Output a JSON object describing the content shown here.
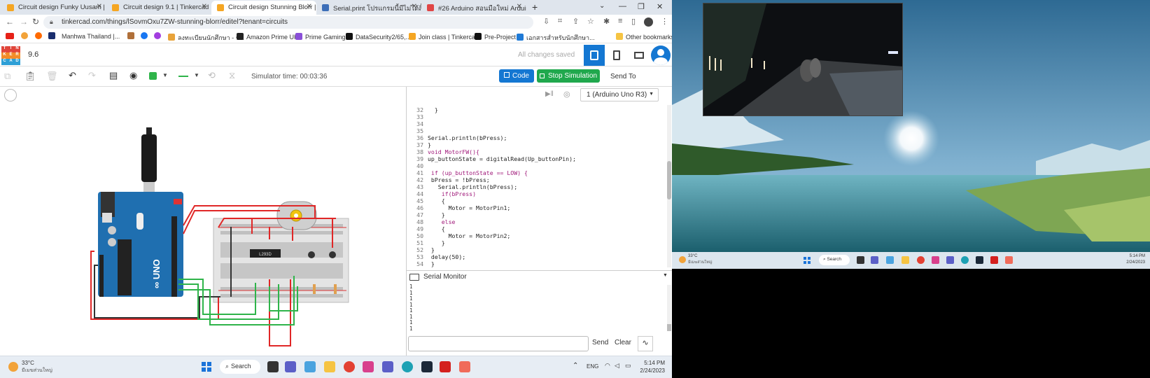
{
  "browser": {
    "tabs": [
      {
        "title": "Circuit design Funky Uusam | Tin",
        "active": false
      },
      {
        "title": "Circuit design 9.1 | Tinkercad",
        "active": false
      },
      {
        "title": "Circuit design Stunning Blorr | Ti",
        "active": true
      },
      {
        "title": "Serial.print โปรแกรมนี้มีไม่ได้สิ้นไม่ออก",
        "active": false
      },
      {
        "title": "#26 Arduino สอนมือใหม่ Arduino",
        "active": false
      }
    ],
    "new_tab": "+",
    "url": "tinkercad.com/things/lSovmOxu7ZW-stunning-blorr/editel?tenant=circuits",
    "bookmarks": [
      "Manhwa Thailand |...",
      "ลงทะเบียนนักศึกษา - ร...",
      "Amazon Prime UK",
      "Prime Gaming",
      "DataSecurity2/65,...",
      "Join class | Tinkercad",
      "Pre-Project",
      "เอกสารสำหรับนักศึกษา..."
    ],
    "other_bookmarks": "Other bookmarks"
  },
  "tinkercad": {
    "logo": [
      "TIN",
      "KER",
      "CAD"
    ],
    "project_name": "9.6",
    "save_status": "All changes saved",
    "simulator_time": "Simulator time: 00:03:36",
    "code_button": "Code",
    "stop_button": "Stop Simulation",
    "send_to": "Send To",
    "board_select": "1 (Arduino Uno R3)",
    "chip_label": "L293D",
    "colors": {
      "accent": "#1477d2",
      "stop": "#20a84d",
      "led": "#2fb44a"
    }
  },
  "code_lines": [
    {
      "n": "32",
      "t": "  }"
    },
    {
      "n": "33",
      "t": ""
    },
    {
      "n": "34",
      "t": ""
    },
    {
      "n": "35",
      "t": ""
    },
    {
      "n": "36",
      "t": "Serial.println(bPress);"
    },
    {
      "n": "37",
      "t": "}"
    },
    {
      "n": "38",
      "t": "void MotorFW(){"
    },
    {
      "n": "39",
      "t": "up_buttonState = digitalRead(Up_buttonPin);"
    },
    {
      "n": "40",
      "t": ""
    },
    {
      "n": "41",
      "t": " if (up_buttonState == LOW) {"
    },
    {
      "n": "42",
      "t": " bPress = !bPress;"
    },
    {
      "n": "43",
      "t": "   Serial.println(bPress);"
    },
    {
      "n": "44",
      "t": "    if(bPress)"
    },
    {
      "n": "45",
      "t": "    {"
    },
    {
      "n": "46",
      "t": "      Motor = MotorPin1;"
    },
    {
      "n": "47",
      "t": "    }"
    },
    {
      "n": "48",
      "t": "    else"
    },
    {
      "n": "49",
      "t": "    {"
    },
    {
      "n": "50",
      "t": "      Motor = MotorPin2;"
    },
    {
      "n": "51",
      "t": "    }"
    },
    {
      "n": "52",
      "t": " }"
    },
    {
      "n": "53",
      "t": " delay(50);"
    },
    {
      "n": "54",
      "t": " }"
    }
  ],
  "serial_monitor": {
    "title": "Serial Monitor",
    "lines": [
      "1",
      "1",
      "1",
      "1",
      "1",
      "1",
      "1",
      "1"
    ],
    "send": "Send",
    "clear": "Clear"
  },
  "taskbar_left": {
    "weather_temp": "33°C",
    "weather_desc": "มีเมฆส่วนใหญ่",
    "search": "Search",
    "lang": "ENG",
    "time": "5:14 PM",
    "date": "2/24/2023"
  },
  "taskbar_right": {
    "weather_temp": "33°C",
    "weather_desc": "มีเมฆส่วนใหญ่",
    "search": "Search",
    "time": "5:14 PM",
    "date": "2/24/2023"
  }
}
